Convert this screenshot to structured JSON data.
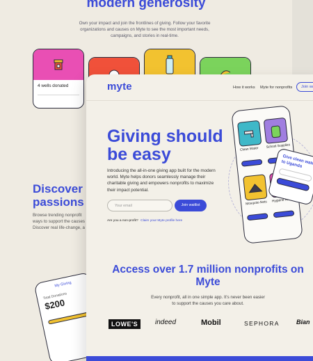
{
  "back_page": {
    "title": "modern generosity",
    "subtitle": "Own your impact and join the frontlines of giving. Follow your favorite organizations and causes on Myte to see the most important needs, campaigns, and stories in real-time.",
    "card_label": "4 wells donated",
    "discover_title": "Discover n",
    "discover_title2": "passions",
    "discover_text": "Browse trending nonprofit ways to support the causes Discover real life-change, a",
    "phone_header": "My Giving",
    "phone_total_label": "Total Donations",
    "phone_total_value": "$200"
  },
  "nav": {
    "logo": "myte",
    "links": [
      "How it works",
      "Myte for nonprofits"
    ],
    "join": "Join waitl"
  },
  "hero": {
    "title": "Giving should be easy",
    "description": "Introducing the all-in-one giving app built for the modern world. Myte helps donors seamlessly manage their charitable giving and empowers nonprofits to maximize their impact potential.",
    "email_placeholder": "Your email",
    "join_button": "Join waitlist",
    "nonprofit_question": "Are you a non-profit?",
    "nonprofit_link": "Claim your Myte profile here"
  },
  "phone": {
    "tiles": [
      "Clean Water",
      "School Supplies",
      "Mosquito Nets",
      "Hygiene Kit"
    ]
  },
  "give_card": {
    "title": "Give clean water",
    "title_line2": "to Uganda"
  },
  "access": {
    "title": "Access over 1.7 million nonprofits on Myte",
    "subtitle": "Every nonprofit, all in one simple app. It's never been easier to support the causes you care about."
  },
  "brands": [
    "LOWE'S",
    "indeed",
    "Mobil",
    "SEPHORA",
    "Bian"
  ],
  "colors": {
    "brand_blue": "#3b4bd8",
    "background": "#f3f0e8",
    "pink": "#e94fb4",
    "red": "#f0513a",
    "yellow": "#f2c230",
    "green": "#7bd35c",
    "purple": "#a07ee0",
    "teal": "#3fb8c8"
  }
}
